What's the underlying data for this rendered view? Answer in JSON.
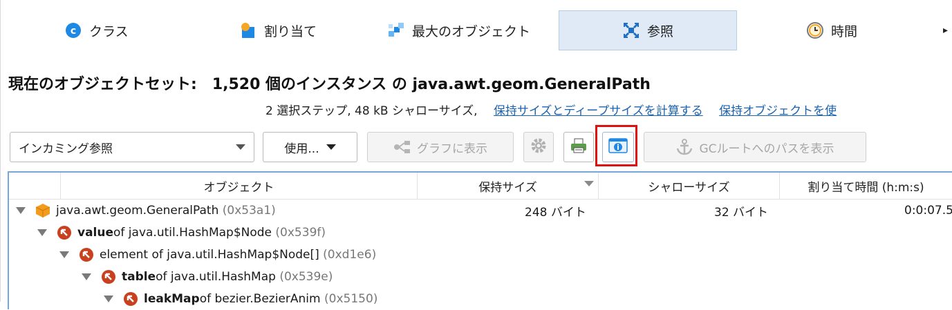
{
  "tabs": [
    {
      "label": "クラス",
      "icon": "class-icon",
      "active": false
    },
    {
      "label": "割り当て",
      "icon": "allocation-icon",
      "active": false
    },
    {
      "label": "最大のオブジェクト",
      "icon": "biggest-objects-icon",
      "active": false
    },
    {
      "label": "参照",
      "icon": "references-icon",
      "active": true
    },
    {
      "label": "時間",
      "icon": "clock-icon",
      "active": false
    }
  ],
  "tab_more": "▸",
  "heading": {
    "prefix": "現在のオブジェクトセット:",
    "count_text": "1,520 個のインスタンス の java.awt.geom.GeneralPath"
  },
  "subline": {
    "info": "2 選択ステップ, 48 kB シャローサイズ,",
    "link_calc": "保持サイズとディープサイズを計算する",
    "link_retained": "保持オブジェクトを使"
  },
  "toolbar": {
    "view_select": "インカミング参照",
    "use_button": "使用...",
    "graph_button": "グラフに表示",
    "gc_button": "GCルートへのパスを表示"
  },
  "table": {
    "columns": [
      "オブジェクト",
      "保持サイズ",
      "シャローサイズ",
      "割り当て時間 (h:m:s)"
    ],
    "rows": [
      {
        "bold": "",
        "text": "java.awt.geom.GeneralPath",
        "addr": "(0x53a1)",
        "retained": "248 バイト",
        "shallow": "32 バイト",
        "time": "0:0:07.5"
      },
      {
        "bold": "value",
        "text": " of java.util.HashMap$Node",
        "addr": "(0x539f)",
        "retained": "",
        "shallow": "",
        "time": ""
      },
      {
        "bold": "",
        "text": "element of java.util.HashMap$Node[]",
        "addr": "(0xd1e6)",
        "retained": "",
        "shallow": "",
        "time": ""
      },
      {
        "bold": "table",
        "text": " of java.util.HashMap",
        "addr": "(0x539e)",
        "retained": "",
        "shallow": "",
        "time": ""
      },
      {
        "bold": "leakMap",
        "text": " of bezier.BezierAnim",
        "addr": "(0x5150)",
        "retained": "",
        "shallow": "",
        "time": ""
      }
    ]
  },
  "colors": {
    "accent": "#1b62b0",
    "highlight": "#e01010",
    "reference_icon": "#c8401e",
    "object_icon": "#f29b1d"
  }
}
